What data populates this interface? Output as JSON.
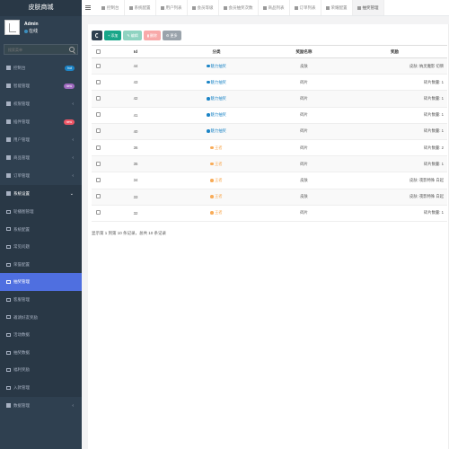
{
  "sidebar": {
    "brand": "皮肤商城",
    "user": {
      "name": "Admin",
      "status": "在线"
    },
    "search_placeholder": "搜索菜单",
    "items": [
      {
        "label": "控制台",
        "badge": "hot",
        "badge_type": "hot"
      },
      {
        "label": "智能管理",
        "badge": "new",
        "badge_type": "new"
      },
      {
        "label": "权限管理",
        "chevron": "‹"
      },
      {
        "label": "插件管理",
        "badge": "new",
        "badge_type": "new-red"
      },
      {
        "label": "用户管理",
        "chevron": "‹"
      },
      {
        "label": "商品管理",
        "chevron": "‹"
      },
      {
        "label": "订单管理",
        "chevron": "‹"
      },
      {
        "label": "系统设置",
        "chevron": "⌄"
      }
    ],
    "sub_items": [
      {
        "label": "轮播图管理"
      },
      {
        "label": "系统配置"
      },
      {
        "label": "常见问题"
      },
      {
        "label": "荣誉配置"
      },
      {
        "label": "抽奖管理"
      },
      {
        "label": "客服管理"
      },
      {
        "label": "邀请好友奖励"
      },
      {
        "label": "活动数据"
      },
      {
        "label": "抽奖数据"
      },
      {
        "label": "福利奖励"
      },
      {
        "label": "入款管理"
      }
    ],
    "bottom_item": {
      "label": "数据管理",
      "chevron": "‹"
    }
  },
  "topbar": {
    "tabs": [
      {
        "label": "控制台"
      },
      {
        "label": "系统配置"
      },
      {
        "label": "用户列表"
      },
      {
        "label": "会员等级"
      },
      {
        "label": "会员抽奖次数"
      },
      {
        "label": "商品列表"
      },
      {
        "label": "订单列表"
      },
      {
        "label": "荣耀配置"
      },
      {
        "label": "抽奖管理"
      }
    ]
  },
  "toolbar": {
    "add_label": "添加",
    "edit_label": "编辑",
    "delete_label": "删除",
    "more_label": "更多"
  },
  "table": {
    "headers": [
      "Id",
      "分类",
      "奖励名称",
      "奖励"
    ],
    "rows": [
      {
        "id": "44",
        "category": "魅力抽奖",
        "cat_type": "blue",
        "name": "皮肤",
        "prize": "皮肤: 纳灵魔影 切牌"
      },
      {
        "id": "43",
        "category": "魅力抽奖",
        "cat_type": "blue",
        "name": "碎片",
        "prize": "碎片数量: 1"
      },
      {
        "id": "42",
        "category": "魅力抽奖",
        "cat_type": "blue",
        "name": "碎片",
        "prize": "碎片数量: 1"
      },
      {
        "id": "41",
        "category": "魅力抽奖",
        "cat_type": "blue",
        "name": "碎片",
        "prize": "碎片数量: 1"
      },
      {
        "id": "40",
        "category": "魅力抽奖",
        "cat_type": "blue",
        "name": "碎片",
        "prize": "碎片数量: 1"
      },
      {
        "id": "36",
        "category": "王者",
        "cat_type": "orange",
        "name": "碎片",
        "prize": "碎片数量: 2"
      },
      {
        "id": "35",
        "category": "王者",
        "cat_type": "orange",
        "name": "碎片",
        "prize": "碎片数量: 1"
      },
      {
        "id": "34",
        "category": "王者",
        "cat_type": "orange",
        "name": "皮肤",
        "prize": "皮肤: 夜影特殊 白起"
      },
      {
        "id": "33",
        "category": "王者",
        "cat_type": "orange",
        "name": "皮肤",
        "prize": "皮肤: 夜影特殊 白起"
      },
      {
        "id": "32",
        "category": "王者",
        "cat_type": "orange",
        "name": "碎片",
        "prize": "碎片数量: 1"
      }
    ]
  },
  "footer_text": "显示第 1 到第 10 条记录，总共 10 条记录",
  "colors": {
    "sidebar_bg": "#2f4050",
    "active_item": "#4f6fe0",
    "add": "#18a689",
    "blue": "#1c84c6",
    "orange": "#f8ac59"
  }
}
